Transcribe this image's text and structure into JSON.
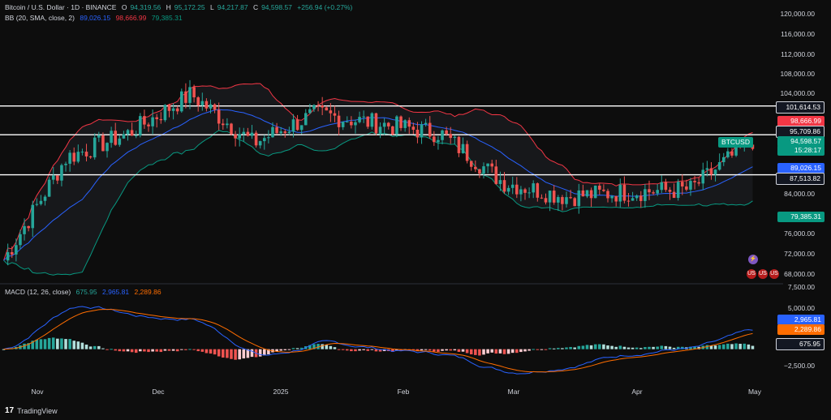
{
  "legend": {
    "symbol": "Bitcoin / U.S. Dollar · 1D · BINANCE",
    "open_label": "O",
    "open": "94,319.56",
    "high_label": "H",
    "high": "95,172.25",
    "low_label": "L",
    "low": "94,217.87",
    "close_label": "C",
    "close": "94,598.57",
    "change": "+256.94 (+0.27%)",
    "bb_label": "BB (20, SMA, close, 2)",
    "bb_basis": "89,026.15",
    "bb_upper": "98,666.99",
    "bb_lower": "79,385.31",
    "macd_label": "MACD (12, 26, close)",
    "macd_hist": "675.95",
    "macd_line": "2,965.81",
    "macd_signal": "2,289.86"
  },
  "price_axis_labels": [
    "120,000.00",
    "116,000.00",
    "112,000.00",
    "108,000.00",
    "104,000.00",
    "84,000.00",
    "76,000.00",
    "72,000.00",
    "68,000.00"
  ],
  "macd_axis_labels": [
    "7,500.00",
    "5,000.00",
    "−2,500.00"
  ],
  "tags": {
    "line1": "101,614.53",
    "line2": "95,709.86",
    "line3": "87,513.82",
    "bb_upper": "98,666.99",
    "symbol": "BTCUSD",
    "last_price": "94,598.57",
    "countdown": "15:28:17",
    "bb_basis": "89,026.15",
    "bb_lower": "79,385.31",
    "macd_line": "2,965.81",
    "macd_signal": "2,289.86",
    "macd_hist": "675.95"
  },
  "time_axis": [
    "Nov",
    "Dec",
    "2025",
    "Feb",
    "Mar",
    "Apr",
    "May"
  ],
  "brand": "TradingView",
  "colors": {
    "up": "#26a69a",
    "down": "#ef5350",
    "bb_upper": "#f23645",
    "bb_lower": "#089981",
    "bb_basis": "#2962ff",
    "macd": "#2962ff",
    "signal": "#ff6d00"
  },
  "chart_data": {
    "type": "candlestick",
    "title": "Bitcoin / U.S. Dollar · 1D · BINANCE",
    "price_range": [
      66000,
      122000
    ],
    "horizontal_lines": [
      101614.53,
      95709.86,
      87513.82
    ],
    "monthly_anchor_closes": {
      "Nov": 70000,
      "mid_Nov": 91000,
      "Dec": 96000,
      "mid_Dec": 104000,
      "2025": 94000,
      "mid_Jan": 100000,
      "Feb": 98000,
      "mid_Feb": 96000,
      "Mar": 86000,
      "mid_Mar": 83000,
      "Apr": 84000,
      "mid_Apr": 84500,
      "May": 94600
    },
    "macd_range": [
      -4000,
      8000
    ]
  }
}
